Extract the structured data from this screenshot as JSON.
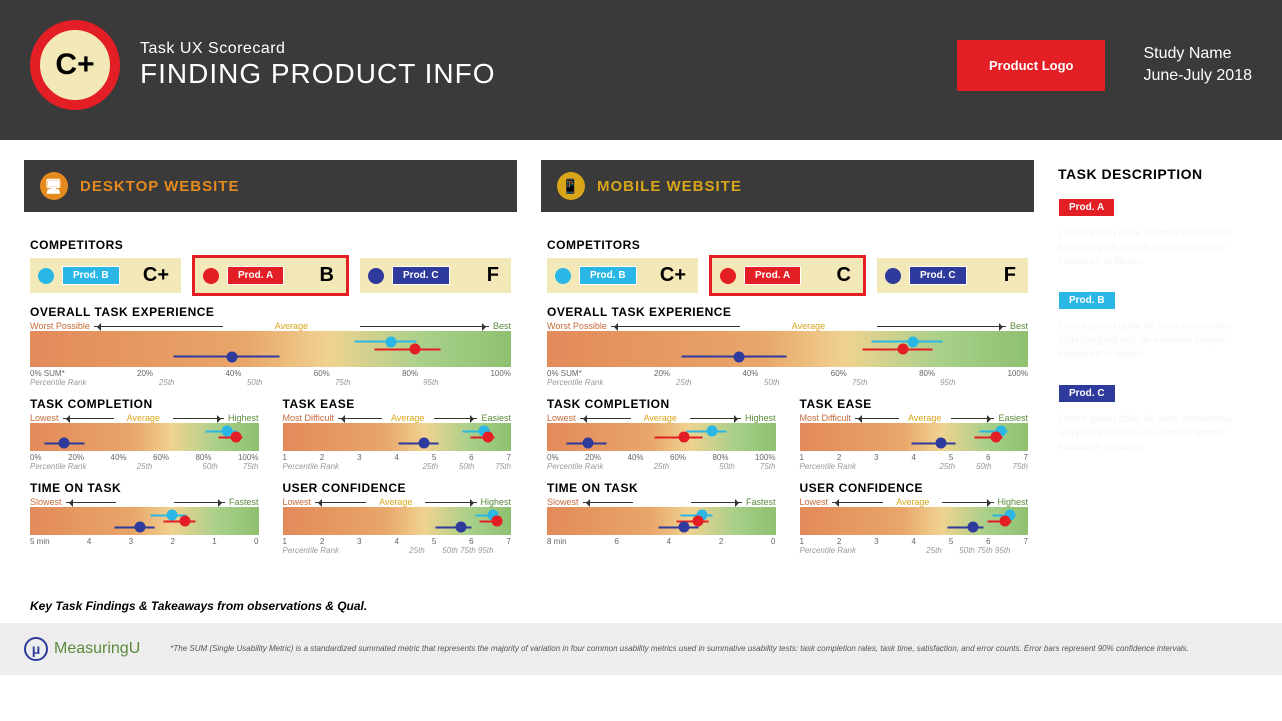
{
  "header": {
    "grade": "C+",
    "sub": "Task UX Scorecard",
    "main": "FINDING PRODUCT INFO",
    "logo": "Product Logo",
    "study": "Study Name",
    "date": "June-July 2018"
  },
  "platforms": [
    {
      "key": "desktop",
      "title": "DESKTOP WEBSITE",
      "icon": "🖥"
    },
    {
      "key": "mobile",
      "title": "MOBILE WEBSITE",
      "icon": "📱"
    }
  ],
  "labels": {
    "competitors": "COMPETITORS",
    "overall": "OVERALL TASK EXPERIENCE",
    "completion": "TASK COMPLETION",
    "ease": "TASK EASE",
    "time": "TIME ON TASK",
    "confidence": "USER CONFIDENCE",
    "worst": "Worst Possible",
    "avg": "Average",
    "best": "Best",
    "lowest": "Lowest",
    "highest": "Highest",
    "difficult": "Most Difficult",
    "easiest": "Easiest",
    "slowest": "Slowest",
    "fastest": "Fastest",
    "percentile": "Percentile Rank",
    "sum": "0% SUM*"
  },
  "competitors": {
    "desktop": [
      {
        "name": "Prod. B",
        "grade": "C+",
        "color": "blue"
      },
      {
        "name": "Prod. A",
        "grade": "B",
        "color": "red",
        "highlight": true
      },
      {
        "name": "Prod. C",
        "grade": "F",
        "color": "navy"
      }
    ],
    "mobile": [
      {
        "name": "Prod. B",
        "grade": "C+",
        "color": "blue"
      },
      {
        "name": "Prod. A",
        "grade": "C",
        "color": "red",
        "highlight": true
      },
      {
        "name": "Prod. C",
        "grade": "F",
        "color": "navy"
      }
    ]
  },
  "chart_data": {
    "desktop": {
      "overall": {
        "type": "dot",
        "range": [
          0,
          100
        ],
        "ticks": [
          "0% SUM*",
          "20%",
          "40%",
          "60%",
          "80%",
          "100%"
        ],
        "pr": [
          "Percentile Rank",
          "25th",
          "50th",
          "75th",
          "95th",
          ""
        ],
        "series": [
          {
            "name": "Prod. B",
            "pos": 75,
            "ci": [
              68,
              82
            ],
            "y": 30
          },
          {
            "name": "Prod. A",
            "pos": 80,
            "ci": [
              72,
              87
            ],
            "y": 50
          },
          {
            "name": "Prod. C",
            "pos": 42,
            "ci": [
              30,
              54
            ],
            "y": 72
          }
        ]
      },
      "completion": {
        "type": "dot",
        "range": [
          0,
          100
        ],
        "ticks": [
          "0%",
          "20%",
          "40%",
          "60%",
          "80%",
          "100%"
        ],
        "pr": [
          "Percentile Rank",
          "",
          "25th",
          "",
          "50th",
          "75th"
        ],
        "series": [
          {
            "name": "Prod. B",
            "pos": 86,
            "ci": [
              78,
              94
            ],
            "y": 30
          },
          {
            "name": "Prod. A",
            "pos": 90,
            "ci": [
              84,
              96
            ],
            "y": 50
          },
          {
            "name": "Prod. C",
            "pos": 15,
            "ci": [
              8,
              28
            ],
            "y": 72
          }
        ]
      },
      "ease": {
        "type": "dot",
        "range": [
          1,
          7
        ],
        "ticks": [
          "1",
          "2",
          "3",
          "4",
          "5",
          "6",
          "7"
        ],
        "pr": [
          "Percentile Rank",
          "",
          "",
          "",
          "25th",
          "50th",
          "75th"
        ],
        "series": [
          {
            "name": "Prod. B",
            "pos": 88,
            "ci": [
              80,
              94
            ],
            "y": 30
          },
          {
            "name": "Prod. A",
            "pos": 90,
            "ci": [
              84,
              96
            ],
            "y": 50
          },
          {
            "name": "Prod. C",
            "pos": 62,
            "ci": [
              52,
              72
            ],
            "y": 72
          }
        ]
      },
      "time": {
        "type": "dot",
        "range": [
          5,
          0
        ],
        "ticks": [
          "5 min",
          "4",
          "3",
          "2",
          "1",
          "0"
        ],
        "series": [
          {
            "name": "Prod. B",
            "pos": 62,
            "ci": [
              54,
              72
            ],
            "y": 30
          },
          {
            "name": "Prod. A",
            "pos": 68,
            "ci": [
              60,
              76
            ],
            "y": 50
          },
          {
            "name": "Prod. C",
            "pos": 48,
            "ci": [
              38,
              58
            ],
            "y": 72
          }
        ]
      },
      "confidence": {
        "type": "dot",
        "range": [
          1,
          7
        ],
        "ticks": [
          "1",
          "2",
          "3",
          "4",
          "5",
          "6",
          "7"
        ],
        "pr": [
          "Percentile Rank",
          "",
          "",
          "",
          "25th",
          "50th 75th 95th",
          ""
        ],
        "series": [
          {
            "name": "Prod. B",
            "pos": 92,
            "ci": [
              86,
              97
            ],
            "y": 30
          },
          {
            "name": "Prod. A",
            "pos": 94,
            "ci": [
              88,
              98
            ],
            "y": 50
          },
          {
            "name": "Prod. C",
            "pos": 78,
            "ci": [
              68,
              86
            ],
            "y": 72
          }
        ]
      }
    },
    "mobile": {
      "overall": {
        "type": "dot",
        "range": [
          0,
          100
        ],
        "ticks": [
          "0% SUM*",
          "20%",
          "40%",
          "60%",
          "80%",
          "100%"
        ],
        "pr": [
          "Percentile Rank",
          "25th",
          "50th",
          "75th",
          "95th",
          ""
        ],
        "series": [
          {
            "name": "Prod. B",
            "pos": 76,
            "ci": [
              68,
              84
            ],
            "y": 30
          },
          {
            "name": "Prod. A",
            "pos": 74,
            "ci": [
              66,
              82
            ],
            "y": 50
          },
          {
            "name": "Prod. C",
            "pos": 40,
            "ci": [
              28,
              52
            ],
            "y": 72
          }
        ]
      },
      "completion": {
        "type": "dot",
        "range": [
          0,
          100
        ],
        "ticks": [
          "0%",
          "20%",
          "40%",
          "60%",
          "80%",
          "100%"
        ],
        "pr": [
          "Percentile Rank",
          "",
          "25th",
          "",
          "50th",
          "75th"
        ],
        "series": [
          {
            "name": "Prod. B",
            "pos": 72,
            "ci": [
              62,
              82
            ],
            "y": 30
          },
          {
            "name": "Prod. A",
            "pos": 60,
            "ci": [
              48,
              72
            ],
            "y": 50
          },
          {
            "name": "Prod. C",
            "pos": 18,
            "ci": [
              10,
              30
            ],
            "y": 72
          }
        ]
      },
      "ease": {
        "type": "dot",
        "range": [
          1,
          7
        ],
        "ticks": [
          "1",
          "2",
          "3",
          "4",
          "5",
          "6",
          "7"
        ],
        "pr": [
          "Percentile Rank",
          "",
          "",
          "",
          "25th",
          "50th",
          "75th"
        ],
        "series": [
          {
            "name": "Prod. B",
            "pos": 88,
            "ci": [
              80,
              94
            ],
            "y": 30
          },
          {
            "name": "Prod. A",
            "pos": 86,
            "ci": [
              78,
              92
            ],
            "y": 50
          },
          {
            "name": "Prod. C",
            "pos": 62,
            "ci": [
              50,
              72
            ],
            "y": 72
          }
        ]
      },
      "time": {
        "type": "dot",
        "range": [
          8,
          0
        ],
        "ticks": [
          "8 min",
          "6",
          "4",
          "2",
          "0"
        ],
        "series": [
          {
            "name": "Prod. B",
            "pos": 68,
            "ci": [
              60,
              76
            ],
            "y": 30
          },
          {
            "name": "Prod. A",
            "pos": 66,
            "ci": [
              58,
              74
            ],
            "y": 50
          },
          {
            "name": "Prod. C",
            "pos": 60,
            "ci": [
              50,
              70
            ],
            "y": 72
          }
        ]
      },
      "confidence": {
        "type": "dot",
        "range": [
          1,
          7
        ],
        "ticks": [
          "1",
          "2",
          "3",
          "4",
          "5",
          "6",
          "7"
        ],
        "pr": [
          "Percentile Rank",
          "",
          "",
          "",
          "25th",
          "50th 75th 95th",
          ""
        ],
        "series": [
          {
            "name": "Prod. B",
            "pos": 92,
            "ci": [
              86,
              97
            ],
            "y": 30
          },
          {
            "name": "Prod. A",
            "pos": 90,
            "ci": [
              84,
              96
            ],
            "y": 50
          },
          {
            "name": "Prod. C",
            "pos": 76,
            "ci": [
              66,
              84
            ],
            "y": 72
          }
        ]
      }
    }
  },
  "side": {
    "title": "TASK DESCRIPTION",
    "items": [
      {
        "name": "Prod. A",
        "color": "red"
      },
      {
        "name": "Prod. B",
        "color": "blue"
      },
      {
        "name": "Prod. C",
        "color": "navy"
      }
    ]
  },
  "findings": "Key Task Findings & Takeaways from observations & Qual.",
  "footnote": "*The SUM (Single Usability Metric) is a standardized summated metric that represents the majority of variation in four common usability metrics used in summative usability tests: task completion rates, task time, satisfaction, and error counts. Error bars represent 90% confidence intervals.",
  "brand": "MeasuringU"
}
